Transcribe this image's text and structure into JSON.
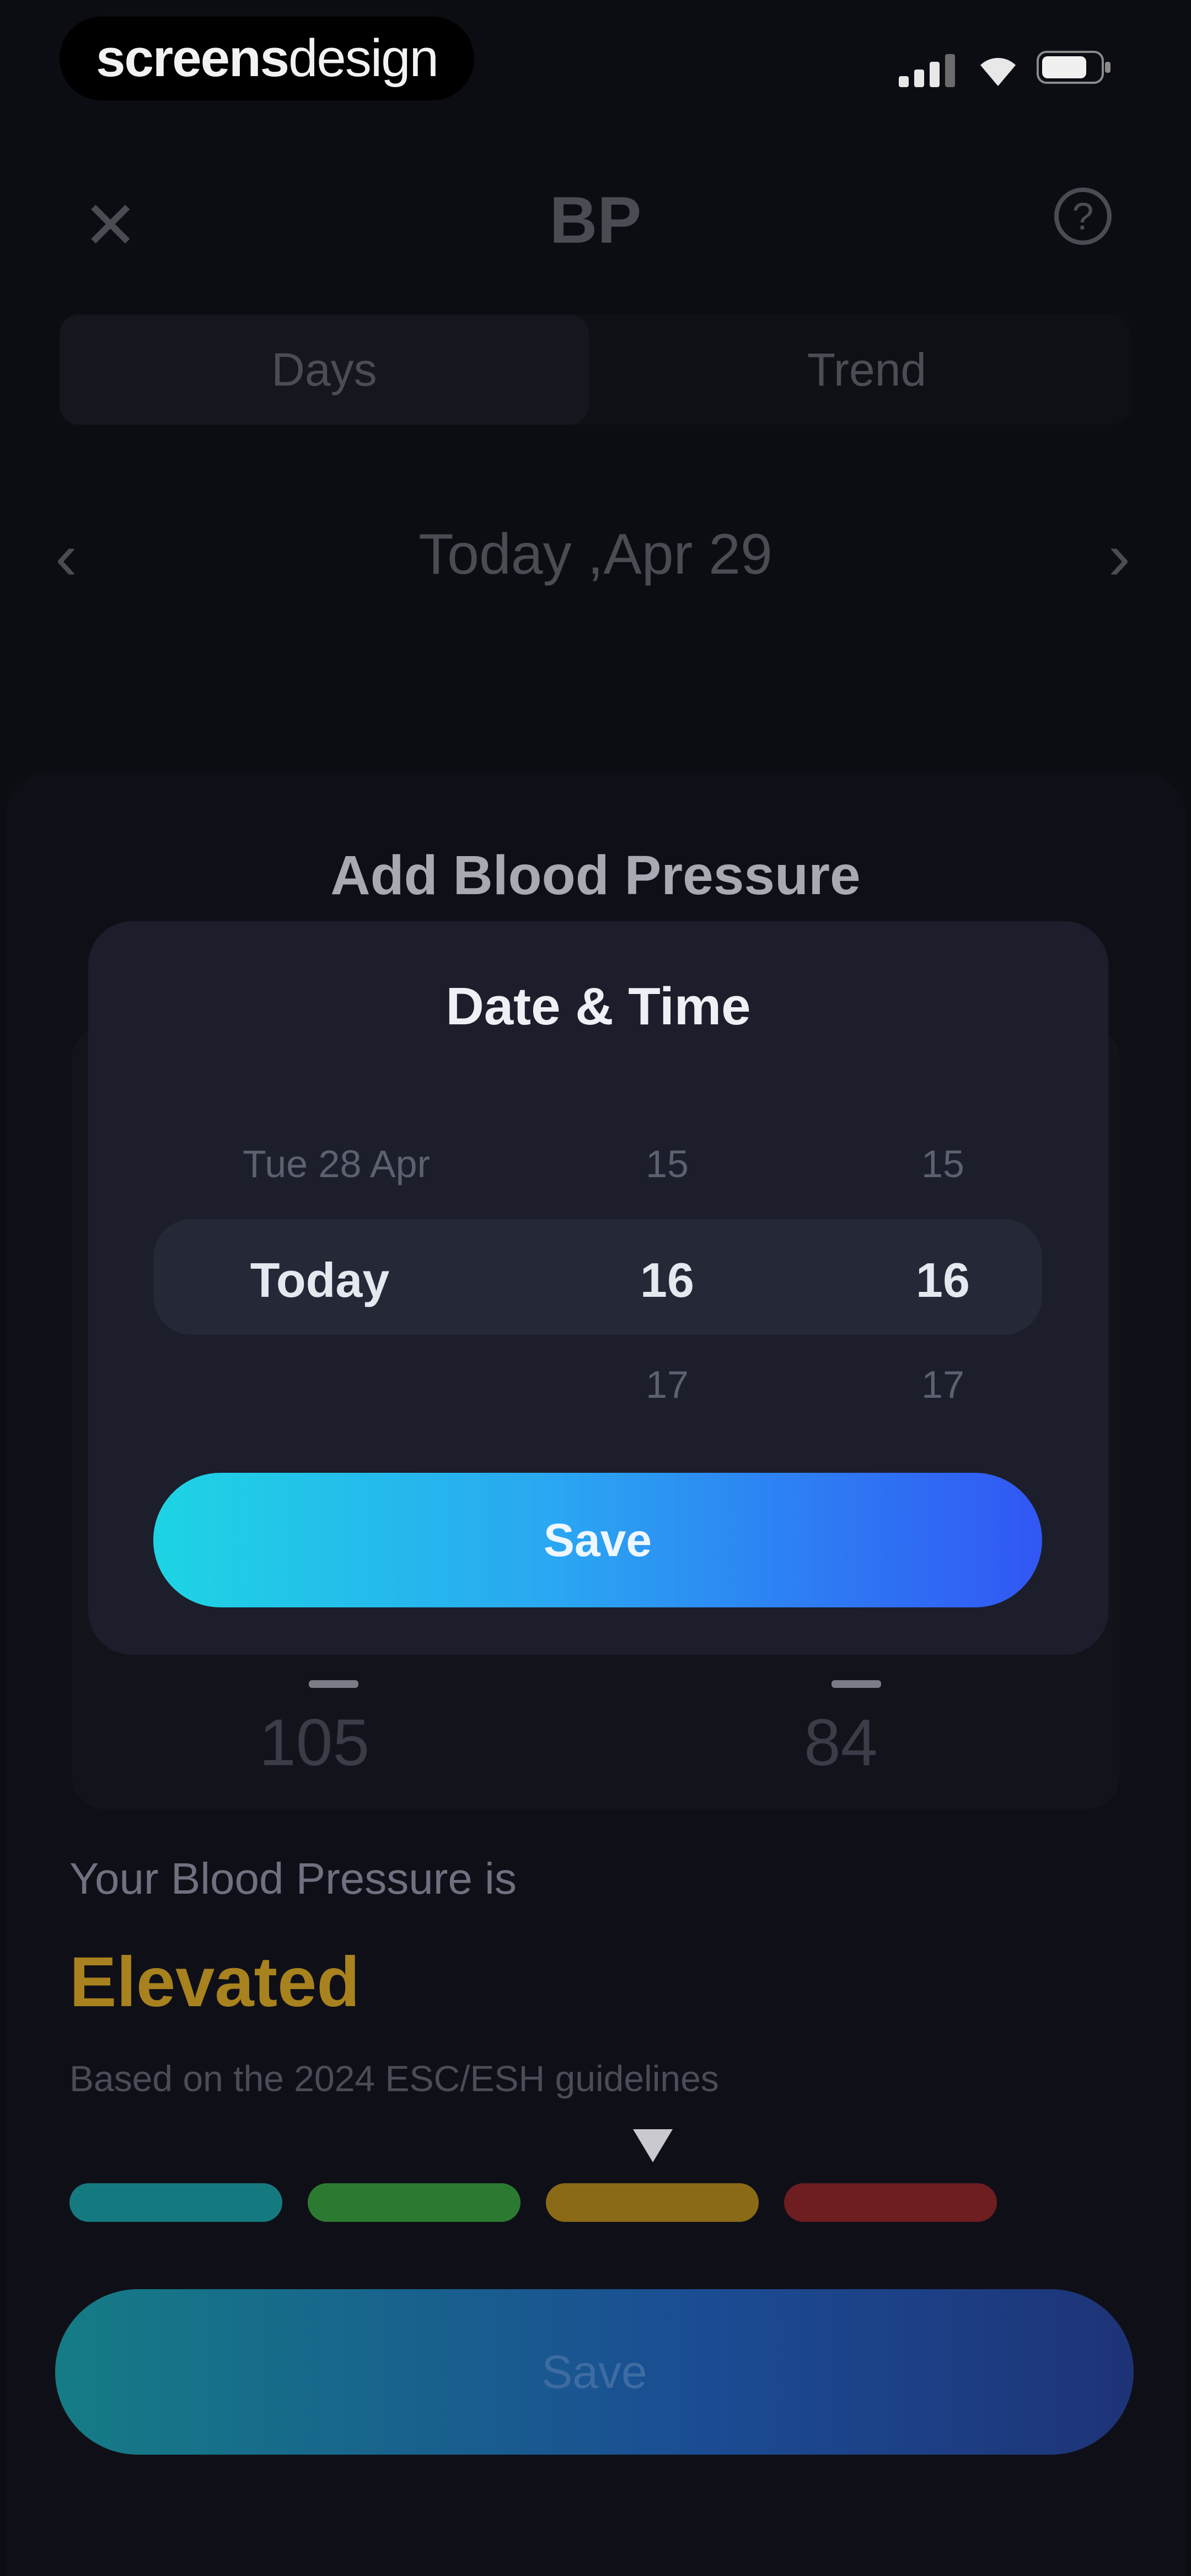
{
  "status_bar": {
    "brand_bold": "screens",
    "brand_light": "design"
  },
  "header": {
    "close_glyph": "✕",
    "title": "BP",
    "help_glyph": "?"
  },
  "tabs": [
    {
      "label": "Days"
    },
    {
      "label": "Trend"
    }
  ],
  "date_nav": {
    "prev_glyph": "‹",
    "label": "Today ,Apr 29",
    "next_glyph": "›"
  },
  "sheet": {
    "title": "Add Blood Pressure",
    "readings": {
      "systolic": "105",
      "diastolic": "84"
    },
    "status_label": "Your Blood Pressure is",
    "status_value": "Elevated",
    "guideline": "Based on the 2024 ESC/ESH guidelines",
    "scale_colors": [
      "#157a80",
      "#2c7a31",
      "#8a6a16",
      "#6e1d21"
    ],
    "marker_index": 2,
    "save_label": "Save"
  },
  "modal": {
    "title": "Date & Time",
    "picker": {
      "day": {
        "prev": "Tue 28 Apr",
        "selected": "Today",
        "next": ""
      },
      "hour": {
        "prev": "15",
        "selected": "16",
        "next": "17"
      },
      "minute": {
        "prev": "15",
        "selected": "16",
        "next": "17"
      }
    },
    "save_label": "Save"
  }
}
